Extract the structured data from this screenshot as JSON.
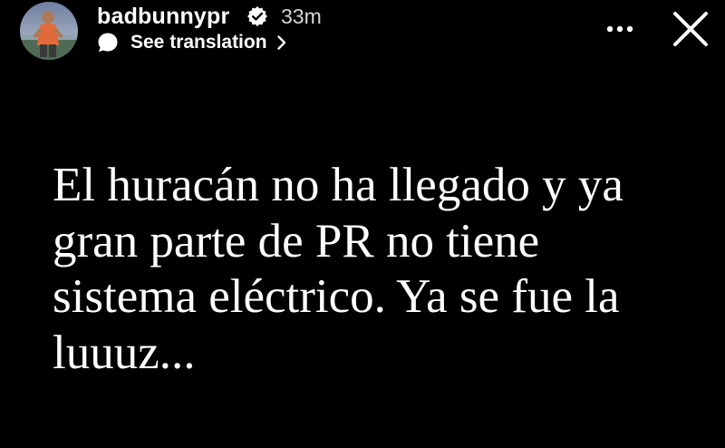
{
  "header": {
    "username": "badbunnypr",
    "timestamp": "33m",
    "verified_icon": "verified-badge-icon",
    "translation_label": "See translation",
    "translation_icon": "translate-bubble-icon",
    "chevron_icon": "chevron-right-icon",
    "more_icon": "more-options-icon",
    "close_icon": "close-icon"
  },
  "story": {
    "text": "El huracán no ha llegado y ya\ngran parte de PR no tiene\nsistema eléctrico. Ya se fue la\nluuuz..."
  },
  "colors": {
    "background": "#000000",
    "text": "#ffffff",
    "timestamp": "#d6d6d6"
  }
}
